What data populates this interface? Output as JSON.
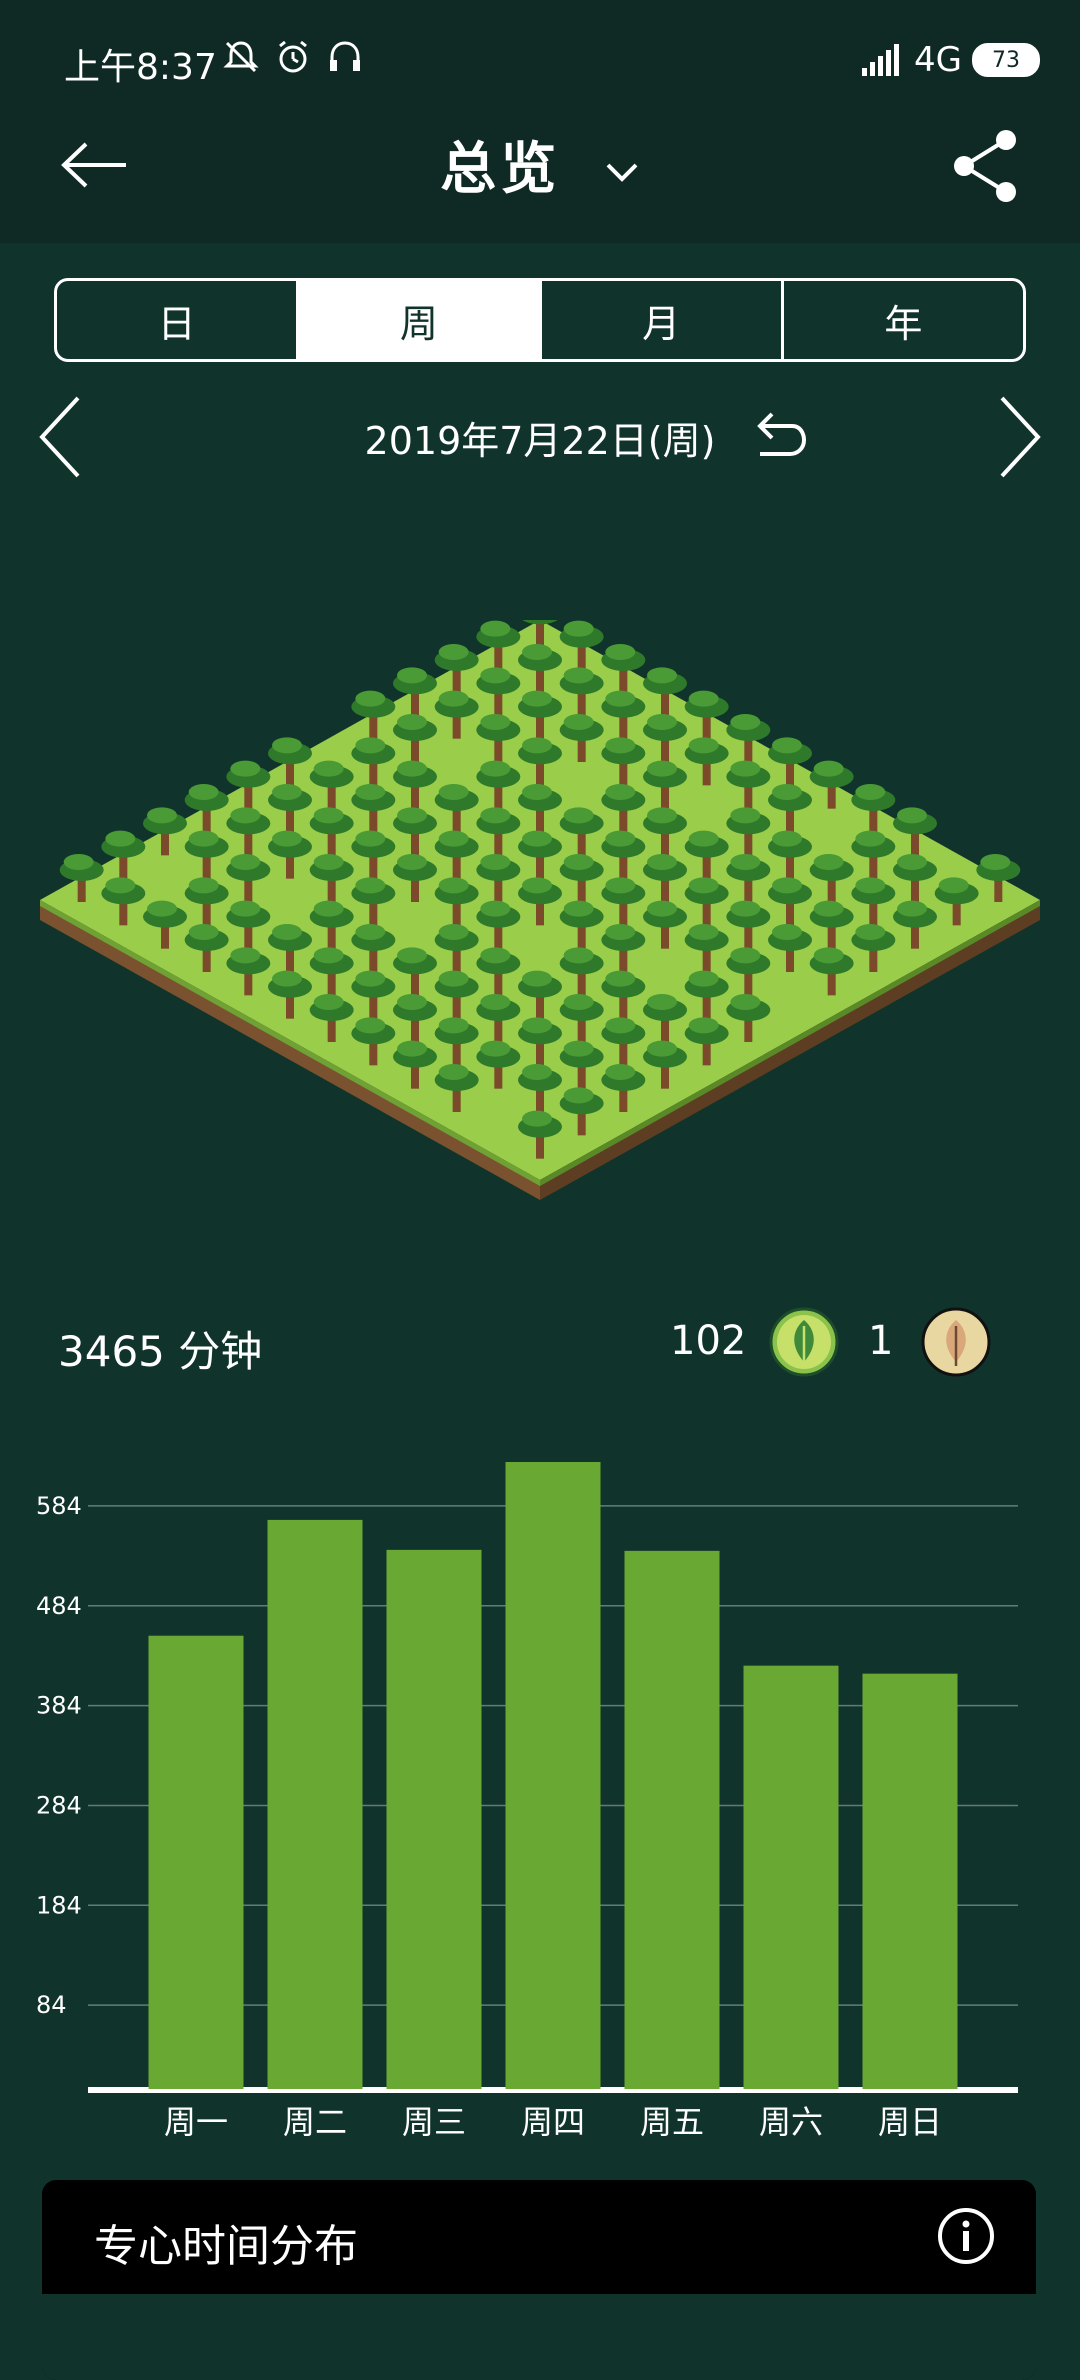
{
  "status": {
    "time": "上午8:37",
    "network": "4G",
    "battery": "73"
  },
  "header": {
    "title": "总览"
  },
  "tabs": [
    "日",
    "周",
    "月",
    "年"
  ],
  "active_tab": 1,
  "date": "2019年7月22日(周)",
  "stats": {
    "minutes": "3465 分钟",
    "alive_count": "102",
    "dead_count": "1"
  },
  "card": {
    "title": "专心时间分布"
  },
  "colors": {
    "bg": "#10342c",
    "header": "#0f2a24",
    "bar": "#6aa834",
    "accent": "#8bc34a"
  },
  "chart_data": {
    "type": "bar",
    "categories": [
      "周一",
      "周二",
      "周三",
      "周四",
      "周五",
      "周六",
      "周日"
    ],
    "values": [
      454,
      570,
      540,
      628,
      539,
      424,
      416
    ],
    "yticks": [
      84,
      184,
      284,
      384,
      484,
      584
    ],
    "ylim": [
      0,
      630
    ],
    "title": "",
    "xlabel": "",
    "ylabel": ""
  }
}
